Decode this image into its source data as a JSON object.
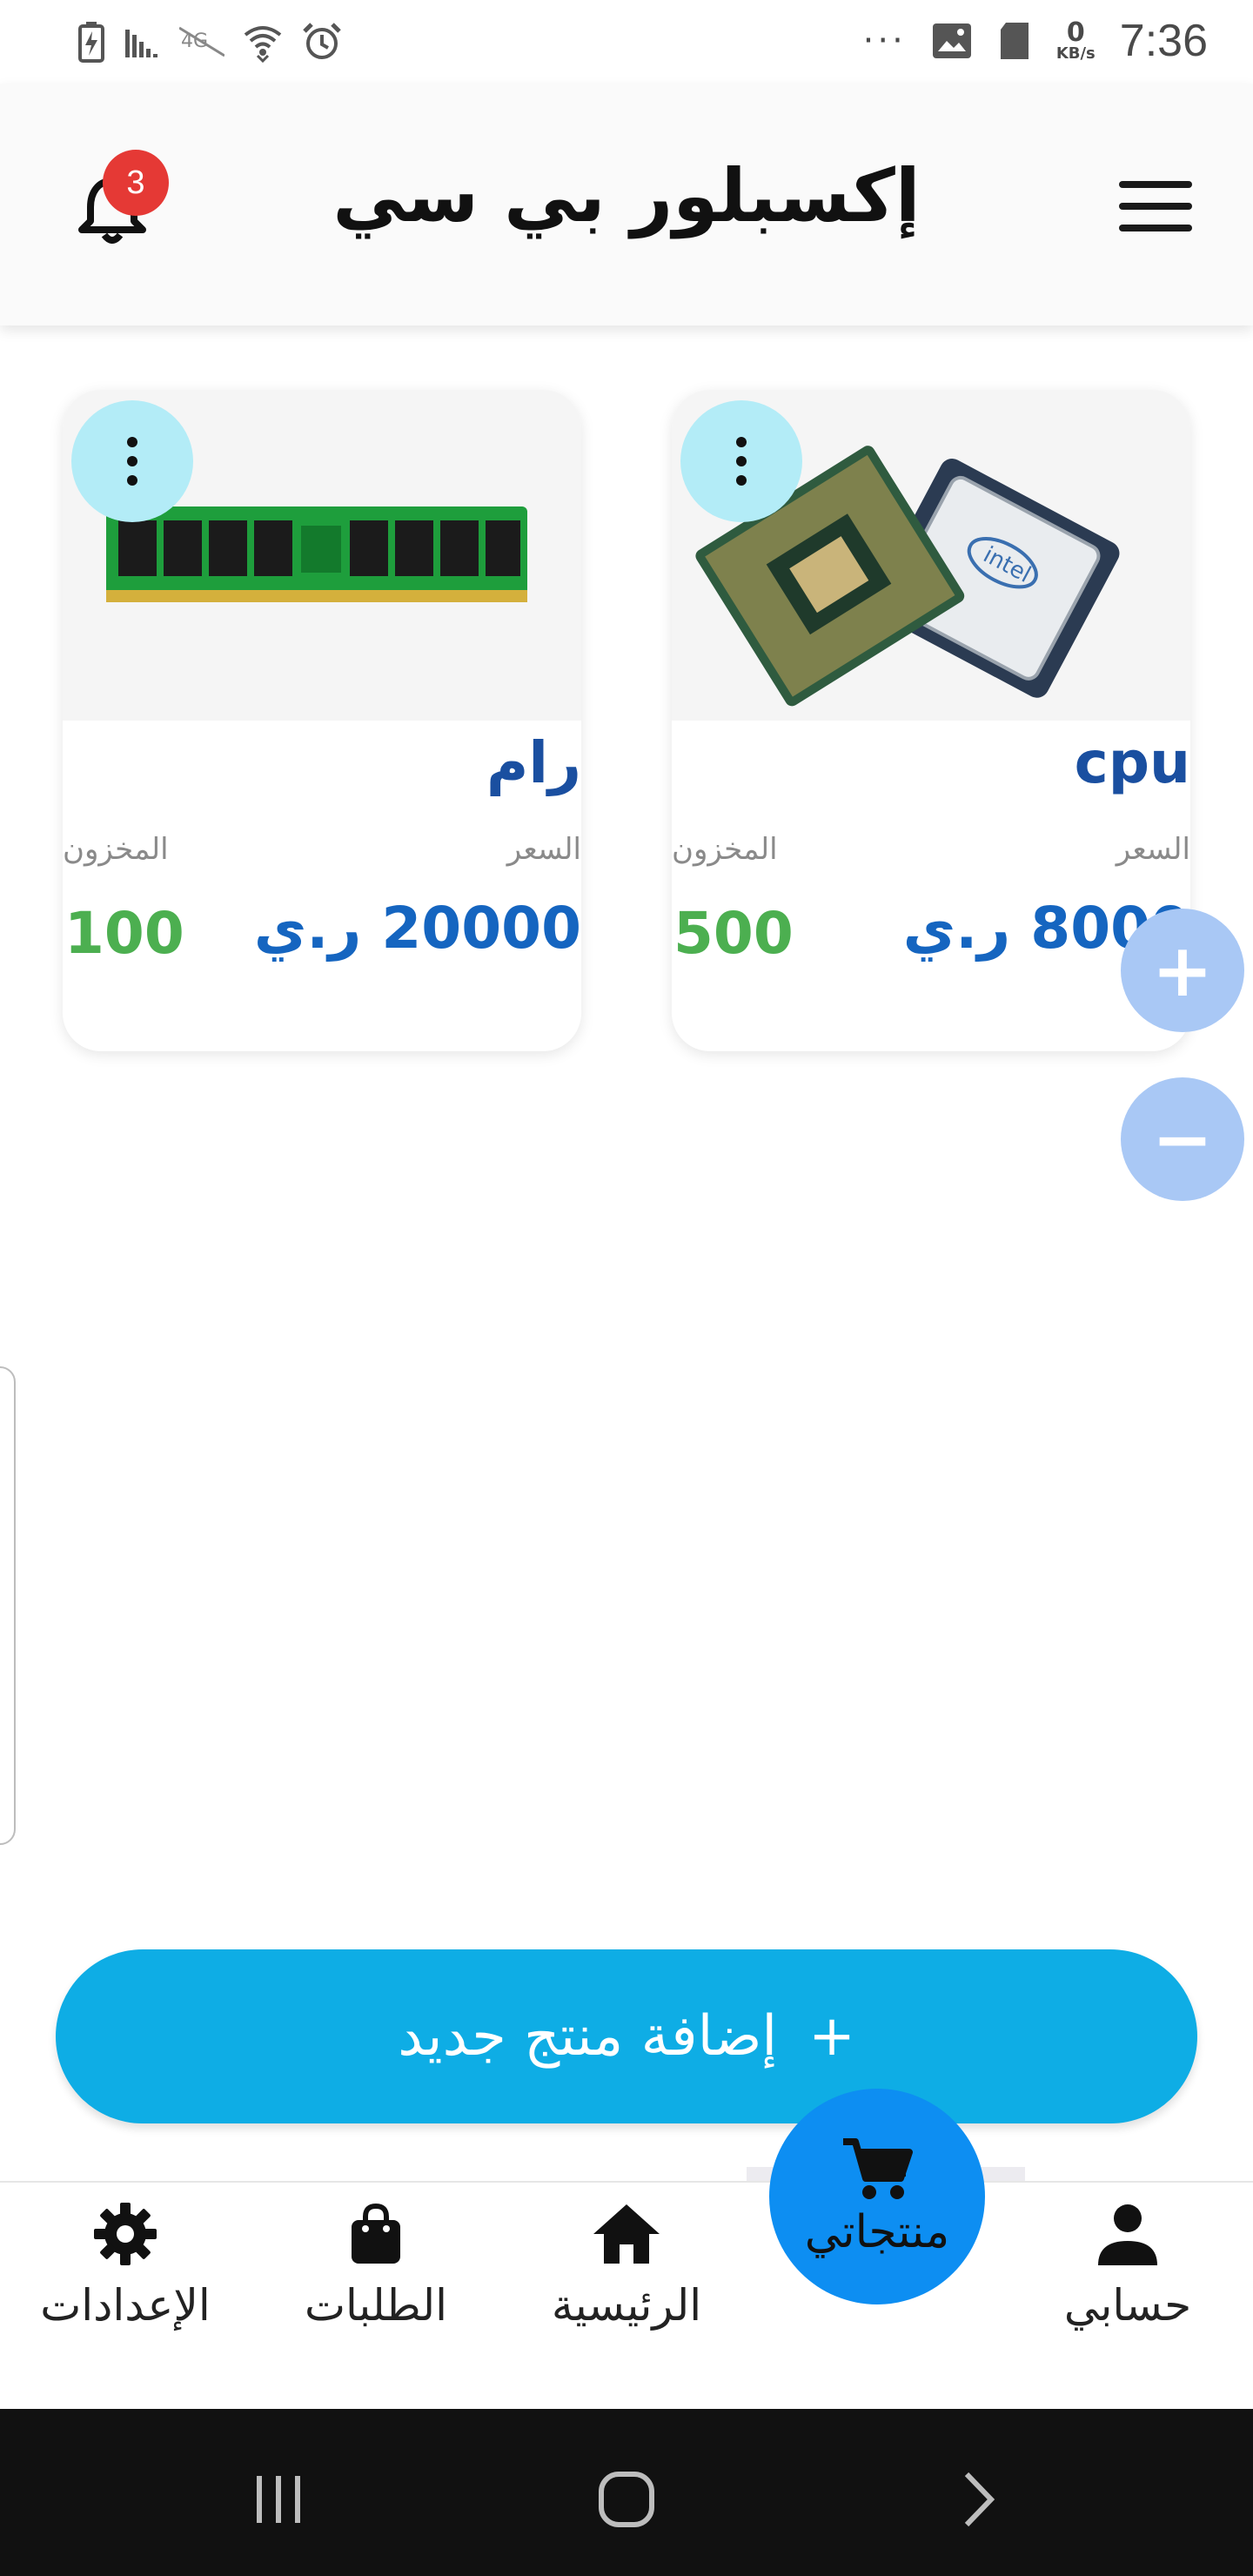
{
  "status_bar": {
    "time": "7:36",
    "net_speed_value": "0",
    "net_speed_unit": "KB/s",
    "more": "···"
  },
  "app_bar": {
    "title": "إكسبلور بي سي",
    "notification_count": "3"
  },
  "products": [
    {
      "name": "cpu",
      "price_label": "السعر",
      "price": "8000 ر.ي",
      "stock_label": "المخزون",
      "stock": "500",
      "image": "cpu-chip-image"
    },
    {
      "name": "رام",
      "price_label": "السعر",
      "price": "20000 ر.ي",
      "stock_label": "المخزون",
      "stock": "100",
      "image": "ram-module-image"
    }
  ],
  "zoom": {
    "in": "+",
    "out": "−"
  },
  "add_product_button": {
    "icon": "+",
    "label": "إضافة منتج جديد"
  },
  "bottom_nav": {
    "items": [
      {
        "label": "الإعدادات",
        "icon": "gear-icon"
      },
      {
        "label": "الطلبات",
        "icon": "shopping-bag-icon"
      },
      {
        "label": "الرئيسية",
        "icon": "home-icon"
      },
      {
        "label": "منتجاتي",
        "icon": "cart-icon",
        "active": true
      },
      {
        "label": "حسابي",
        "icon": "person-icon"
      }
    ]
  },
  "colors": {
    "accent": "#0eade5",
    "active_fab": "#0d8ef2",
    "price": "#1565c0",
    "stock": "#4caf50",
    "badge": "#e53935"
  }
}
